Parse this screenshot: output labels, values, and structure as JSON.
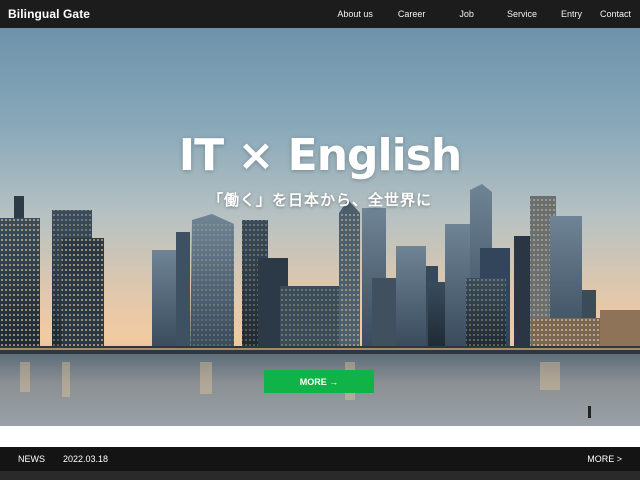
{
  "header": {
    "brand": "Bilingual Gate",
    "nav": [
      "About us",
      "Career",
      "Job",
      "Service",
      "Entry",
      "Contact"
    ]
  },
  "hero": {
    "title": "IT × English",
    "subtitle": "「働く」を日本から、全世界に",
    "more_label": "MORE →"
  },
  "news": {
    "label": "NEWS",
    "date": "2022.03.18",
    "more_label": "MORE >"
  },
  "colors": {
    "header_bg": "#1c1c1c",
    "accent_green": "#10b347",
    "news_bg": "#141414"
  }
}
